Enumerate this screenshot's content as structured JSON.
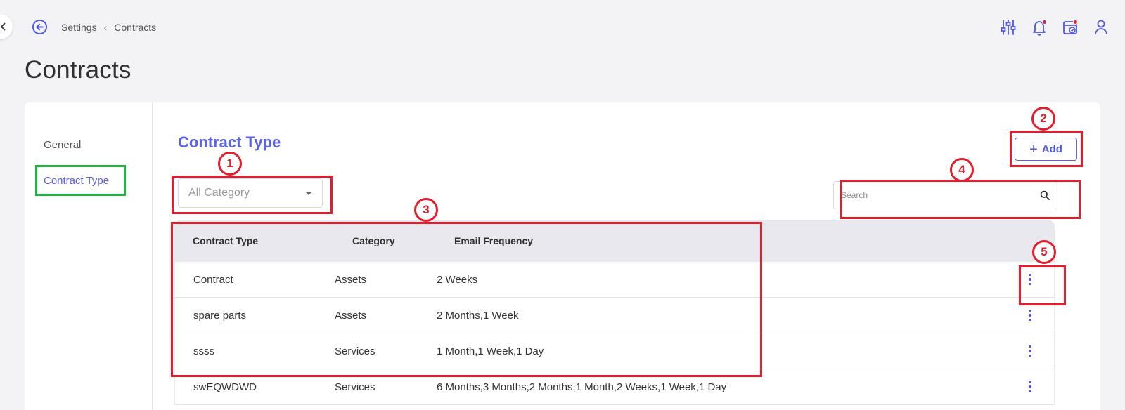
{
  "breadcrumb": {
    "parent": "Settings",
    "current": "Contracts"
  },
  "page_title": "Contracts",
  "side_nav": {
    "items": [
      {
        "label": "General"
      },
      {
        "label": "Contract Type"
      }
    ]
  },
  "section_title": "Contract Type",
  "add_button": {
    "plus": "+",
    "label": "Add"
  },
  "category_select": {
    "selected": "All Category"
  },
  "search": {
    "placeholder": "Search"
  },
  "table": {
    "headers": [
      "Contract Type",
      "Category",
      "Email Frequency"
    ],
    "rows": [
      {
        "type": "Contract",
        "category": "Assets",
        "frequency": "2 Weeks"
      },
      {
        "type": "spare parts",
        "category": "Assets",
        "frequency": "2 Months,1 Week"
      },
      {
        "type": "ssss",
        "category": "Services",
        "frequency": "1 Month,1 Week,1 Day"
      },
      {
        "type": "swEQWDWD",
        "category": "Services",
        "frequency": "6 Months,3 Months,2 Months,1 Month,2 Weeks,1 Week,1 Day"
      }
    ]
  },
  "annotations": [
    "1",
    "2",
    "3",
    "4",
    "5"
  ],
  "colors": {
    "accent": "#5b63e8",
    "annotation_red": "#e51c2b",
    "annotation_green": "#1fb341",
    "badge_red": "#e5173a"
  },
  "icons": [
    "back-arrow-icon",
    "filter-sliders-icon",
    "notification-bell-icon",
    "calendar-check-icon",
    "user-icon",
    "search-icon",
    "more-vertical-icon"
  ]
}
